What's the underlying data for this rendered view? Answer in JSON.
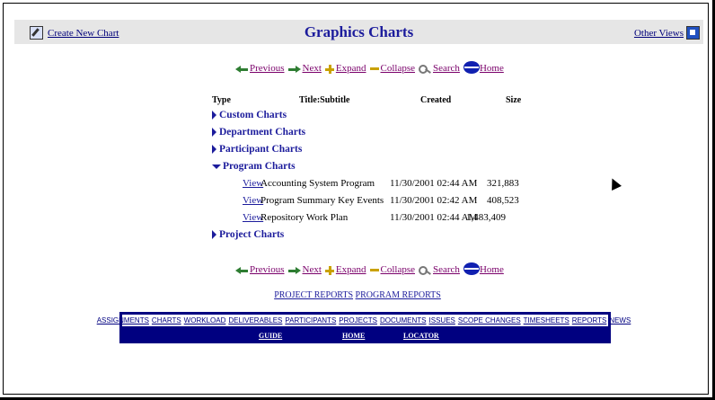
{
  "header": {
    "create_label": "Create New Chart",
    "title": "Graphics Charts",
    "other_views_label": "Other Views"
  },
  "nav": {
    "previous": "Previous",
    "next": "Next",
    "expand": "Expand",
    "collapse": "Collapse",
    "search": "Search",
    "home": "Home"
  },
  "table": {
    "headers": {
      "type": "Type",
      "title": "Title:Subtitle",
      "created": "Created",
      "size": "Size"
    },
    "categories": [
      "Custom Charts",
      "Department Charts",
      "Participant Charts",
      "Program Charts",
      "Project Charts"
    ],
    "rows": [
      {
        "view": "View",
        "title": "Accounting System Program",
        "created": "11/30/2001 02:44 AM",
        "size": "321,883"
      },
      {
        "view": "View",
        "title": "Program Summary Key Events",
        "created": "11/30/2001 02:42 AM",
        "size": "408,523"
      },
      {
        "view": "View",
        "title": "Repository Work Plan",
        "created": "11/30/2001 02:44 AM",
        "size": "1,483,409"
      }
    ]
  },
  "links": {
    "project_reports": "PROJECT REPORTS",
    "program_reports": "PROGRAM REPORTS"
  },
  "menu": {
    "top": [
      "ASSIGNMENTS",
      "CHARTS",
      "WORKLOAD",
      "DELIVERABLES",
      "PARTICIPANTS",
      "PROJECTS",
      "DOCUMENTS",
      "ISSUES",
      "SCOPE CHANGES",
      "TIMESHEETS",
      "REPORTS",
      "NEWS"
    ],
    "bottom": [
      "GUIDE",
      "HOME",
      "LOCATOR"
    ]
  }
}
